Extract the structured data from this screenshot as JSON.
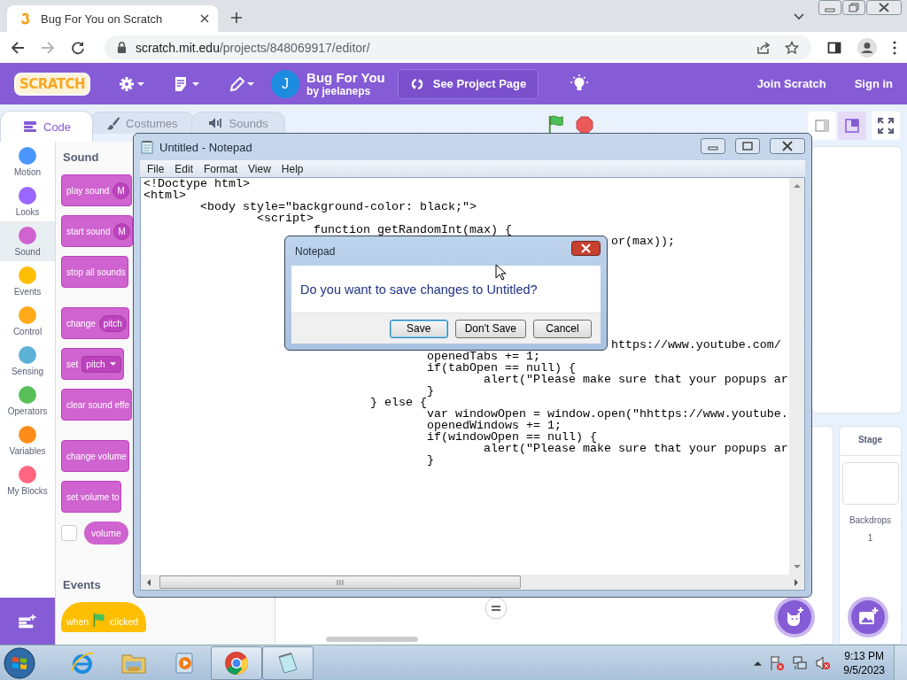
{
  "browser": {
    "tab_title": "Bug For You on Scratch",
    "url_host": "scratch.mit.edu",
    "url_path": "/projects/848069917/editor/"
  },
  "menubar": {
    "logo": "SCRATCH",
    "avatar_letter": "J",
    "project_title": "Bug For You",
    "author": "by jeelaneps",
    "see_project": "See Project Page",
    "join": "Join Scratch",
    "sign_in": "Sign in"
  },
  "editor_tabs": [
    {
      "label": "Code",
      "selected": true
    },
    {
      "label": "Costumes",
      "selected": false
    },
    {
      "label": "Sounds",
      "selected": false
    }
  ],
  "categories": [
    {
      "label": "Motion",
      "color": "#4c97ff",
      "selected": false
    },
    {
      "label": "Looks",
      "color": "#9966ff",
      "selected": false
    },
    {
      "label": "Sound",
      "color": "#cf63cf",
      "selected": true
    },
    {
      "label": "Events",
      "color": "#ffbf00",
      "selected": false
    },
    {
      "label": "Control",
      "color": "#ffab19",
      "selected": false
    },
    {
      "label": "Sensing",
      "color": "#5cb1d6",
      "selected": false
    },
    {
      "label": "Operators",
      "color": "#59c059",
      "selected": false
    },
    {
      "label": "Variables",
      "color": "#ff8c1a",
      "selected": false
    },
    {
      "label": "My Blocks",
      "color": "#ff6680",
      "selected": false
    }
  ],
  "palette": {
    "heading": "Sound",
    "groups": [
      [
        {
          "kind": "stack",
          "text": "play sound",
          "input": "M"
        },
        {
          "kind": "stack",
          "text": "start sound",
          "input": "M"
        },
        {
          "kind": "stack",
          "text": "stop all sounds"
        }
      ],
      [
        {
          "kind": "stack",
          "text": "change",
          "input": "pitch"
        },
        {
          "kind": "stack",
          "text": "set",
          "input": "pitch",
          "dropdown": true
        },
        {
          "kind": "stack",
          "text": "clear sound effe"
        }
      ],
      [
        {
          "kind": "stack",
          "text": "change volume"
        },
        {
          "kind": "stack",
          "text": "set volume to"
        },
        {
          "kind": "reporter",
          "text": "volume",
          "checked": false
        }
      ]
    ],
    "events_heading": "Events",
    "hat": {
      "before": "when",
      "after": "clicked"
    }
  },
  "notepad": {
    "title": "Untitled - Notepad",
    "menu": [
      "File",
      "Edit",
      "Format",
      "View",
      "Help"
    ],
    "code_top": [
      "<!Doctype html>",
      "<html>",
      "\t<body style=\"background-color: black;\">",
      "\t\t<script>",
      "\t\t\tfunction getRandomInt(max) {",
      "\t\t\t\t\t\t\t\t  or(max));"
    ],
    "code_bottom": [
      "\t\t\t\t\t\t\t\t  https://www.youtube.com/",
      "\t\t\t\t\topenedTabs += 1;",
      "\t\t\t\t\tif(tabOpen == null) {",
      "\t\t\t\t\t\talert(\"Please make sure that your popups ar",
      "\t\t\t\t\t}",
      "\t\t\t\t} else {",
      "\t\t\t\t\tvar windowOpen = window.open(\"hhttps://www.youtube.",
      "\t\t\t\t\topenedWindows += 1;",
      "\t\t\t\t\tif(windowOpen == null) {",
      "\t\t\t\t\t\talert(\"Please make sure that your popups ar",
      "\t\t\t\t\t}"
    ]
  },
  "dialog": {
    "title": "Notepad",
    "message": "Do you want to save changes to Untitled?",
    "buttons": [
      {
        "label": "Save",
        "selected": true
      },
      {
        "label": "Don't Save",
        "selected": false
      },
      {
        "label": "Cancel",
        "selected": false
      }
    ]
  },
  "stage_pane": {
    "label": "Stage",
    "backdrops_label": "Backdrops",
    "backdrops_count": "1"
  },
  "taskbar": {
    "apps": [
      {
        "kind": "ie",
        "active": false
      },
      {
        "kind": "explorer",
        "active": false
      },
      {
        "kind": "media",
        "active": false
      },
      {
        "kind": "chrome",
        "active": true
      },
      {
        "kind": "notepad",
        "active": true
      }
    ],
    "time": "9:13 PM",
    "date": "9/5/2023"
  }
}
